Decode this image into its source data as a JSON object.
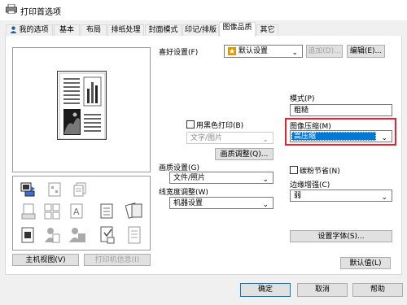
{
  "window": {
    "title": "打印首选项"
  },
  "tabs": [
    {
      "label": "我的选项"
    },
    {
      "label": "基本"
    },
    {
      "label": "布局"
    },
    {
      "label": "排纸处理"
    },
    {
      "label": "封面模式"
    },
    {
      "label": "印记/排版"
    },
    {
      "label": "图像品质"
    },
    {
      "label": "其它"
    }
  ],
  "favorite": {
    "label": "喜好设置(F)",
    "value": "默认设置",
    "add_button": "追加(D)...",
    "edit_button": "编辑(E)..."
  },
  "left_buttons": {
    "main_view": "主机视图(V)",
    "printer_info": "打印机信息(I)"
  },
  "middle": {
    "bw_print": {
      "label": "用黑色打印(B)",
      "checked": false
    },
    "text_photo": {
      "value": "文字/图片"
    },
    "image_adjust_button": "画质调整(Q)...",
    "quality": {
      "label": "画质设置(G)",
      "value": "文件/照片"
    },
    "line_width": {
      "label": "线宽度调整(W)",
      "value": "机器设置"
    }
  },
  "right": {
    "mode": {
      "label": "模式(P)",
      "value": "粗糙"
    },
    "compression": {
      "label": "图像压缩(M)",
      "value": "高压缩"
    },
    "toner_save": {
      "label": "碳粉节省(N)",
      "checked": false
    },
    "edge_enhance": {
      "label": "边缘增强(C)",
      "value": "弱"
    },
    "font_button": "设置字体(S)..."
  },
  "default_button": "默认值(L)",
  "footer": {
    "ok": "确定",
    "cancel": "取消",
    "help": "帮助"
  },
  "colors": {
    "highlight": "#e8212d",
    "selection": "#0078d7"
  }
}
